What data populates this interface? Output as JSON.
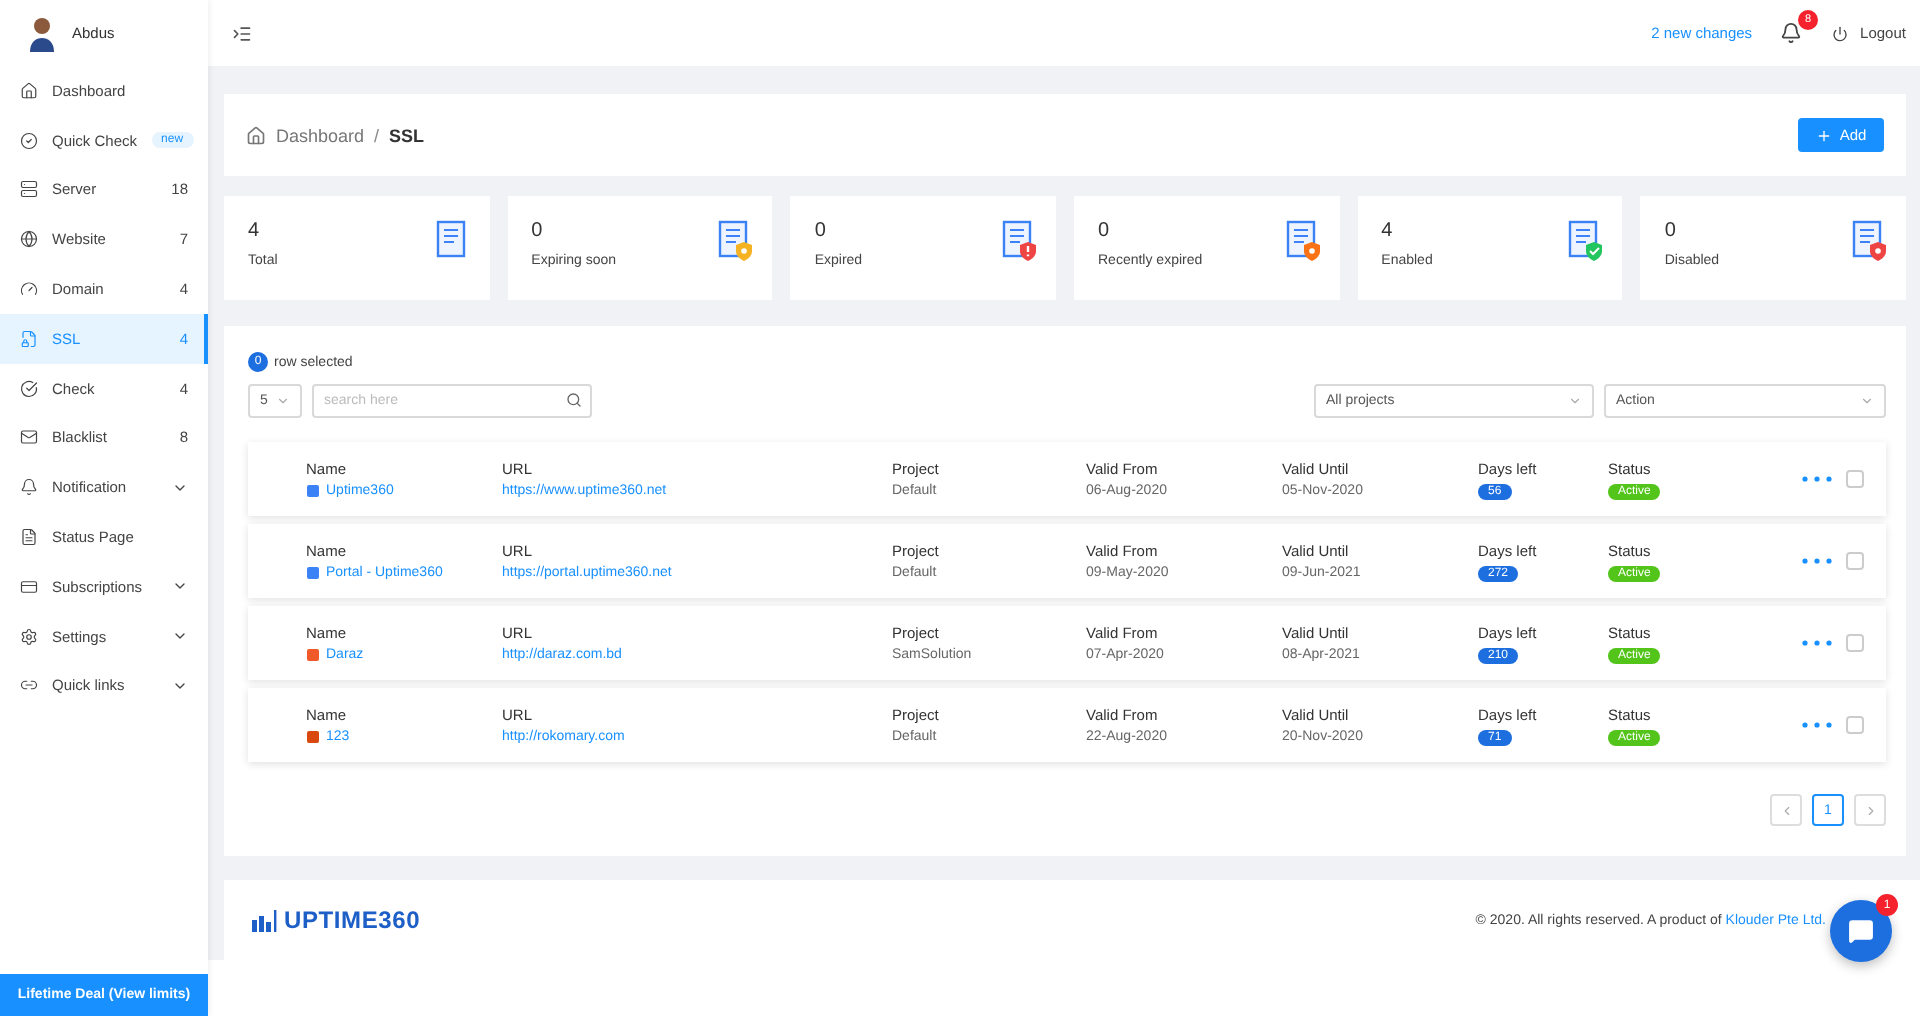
{
  "user": {
    "name": "Abdus"
  },
  "sidebar": {
    "items": [
      {
        "kind": "link",
        "label": "Dashboard",
        "selected": false
      },
      {
        "kind": "link",
        "label": "Quick Check",
        "badge": "new",
        "selected": false
      },
      {
        "kind": "link",
        "label": "Server",
        "count": "18",
        "selected": false
      },
      {
        "kind": "link",
        "label": "Website",
        "count": "7",
        "selected": false
      },
      {
        "kind": "link",
        "label": "Domain",
        "count": "4",
        "selected": false
      },
      {
        "kind": "link",
        "label": "SSL",
        "count": "4",
        "selected": true
      },
      {
        "kind": "link",
        "label": "Check",
        "count": "4",
        "selected": false
      },
      {
        "kind": "link",
        "label": "Blacklist",
        "count": "8",
        "selected": false
      },
      {
        "kind": "menu",
        "label": "Notification",
        "selected": false
      },
      {
        "kind": "link",
        "label": "Status Page",
        "selected": false
      },
      {
        "kind": "menu",
        "label": "Subscriptions",
        "selected": false
      },
      {
        "kind": "menu",
        "label": "Settings",
        "selected": false
      },
      {
        "kind": "menu",
        "label": "Quick links",
        "selected": false
      }
    ],
    "deal_button": "Lifetime Deal (View limits)"
  },
  "topbar": {
    "changes_link": "2 new changes",
    "notification_count": "8",
    "logout": "Logout"
  },
  "breadcrumb": {
    "items": [
      "Dashboard",
      "SSL"
    ],
    "separator": "/"
  },
  "add_button": "Add",
  "stats": [
    {
      "value": "4",
      "label": "Total",
      "kind": "plain"
    },
    {
      "value": "0",
      "label": "Expiring soon",
      "kind": "shield",
      "color": "#f5b323"
    },
    {
      "value": "0",
      "label": "Expired",
      "kind": "alert",
      "color": "#ef4444"
    },
    {
      "value": "0",
      "label": "Recently expired",
      "kind": "shield",
      "color": "#f97316"
    },
    {
      "value": "4",
      "label": "Enabled",
      "kind": "check",
      "color": "#22c55e"
    },
    {
      "value": "0",
      "label": "Disabled",
      "kind": "shield",
      "color": "#ef4444"
    }
  ],
  "table": {
    "selected_count": "0",
    "selected_label": "row selected",
    "page_size": "5",
    "search_placeholder": "search here",
    "project_filter": "All projects",
    "action_select": "Action",
    "rows": [
      {
        "labels": {
          "name": "Name",
          "url": "URL",
          "project": "Project",
          "valid_from": "Valid From",
          "valid_until": "Valid Until",
          "days_left": "Days left",
          "status": "Status"
        },
        "name": "Uptime360",
        "color": "#3b82f6",
        "url": "https://www.uptime360.net",
        "project": "Default",
        "valid_from": "06-Aug-2020",
        "valid_until": "05-Nov-2020",
        "days_left": "56",
        "status": "Active",
        "checked": false
      },
      {
        "labels": {
          "name": "Name",
          "url": "URL",
          "project": "Project",
          "valid_from": "Valid From",
          "valid_until": "Valid Until",
          "days_left": "Days left",
          "status": "Status"
        },
        "name": "Portal - Uptime360",
        "color": "#3b82f6",
        "url": "https://portal.uptime360.net",
        "project": "Default",
        "valid_from": "09-May-2020",
        "valid_until": "09-Jun-2021",
        "days_left": "272",
        "status": "Active",
        "checked": false
      },
      {
        "labels": {
          "name": "Name",
          "url": "URL",
          "project": "Project",
          "valid_from": "Valid From",
          "valid_until": "Valid Until",
          "days_left": "Days left",
          "status": "Status"
        },
        "name": "Daraz",
        "color": "#f05a28",
        "url": "http://daraz.com.bd",
        "project": "SamSolution",
        "valid_from": "07-Apr-2020",
        "valid_until": "08-Apr-2021",
        "days_left": "210",
        "status": "Active",
        "checked": false
      },
      {
        "labels": {
          "name": "Name",
          "url": "URL",
          "project": "Project",
          "valid_from": "Valid From",
          "valid_until": "Valid Until",
          "days_left": "Days left",
          "status": "Status"
        },
        "name": "123",
        "color": "#d9480f",
        "url": "http://rokomary.com",
        "project": "Default",
        "valid_from": "22-Aug-2020",
        "valid_until": "20-Nov-2020",
        "days_left": "71",
        "status": "Active",
        "checked": false
      }
    ],
    "pages": [
      {
        "label": "1",
        "selected": true
      }
    ]
  },
  "footer": {
    "logo": "UPTIME360",
    "copyright": "© 2020. All rights reserved. A product of",
    "company_link": "Klouder Pte Ltd."
  },
  "chat": {
    "unread": "1"
  }
}
